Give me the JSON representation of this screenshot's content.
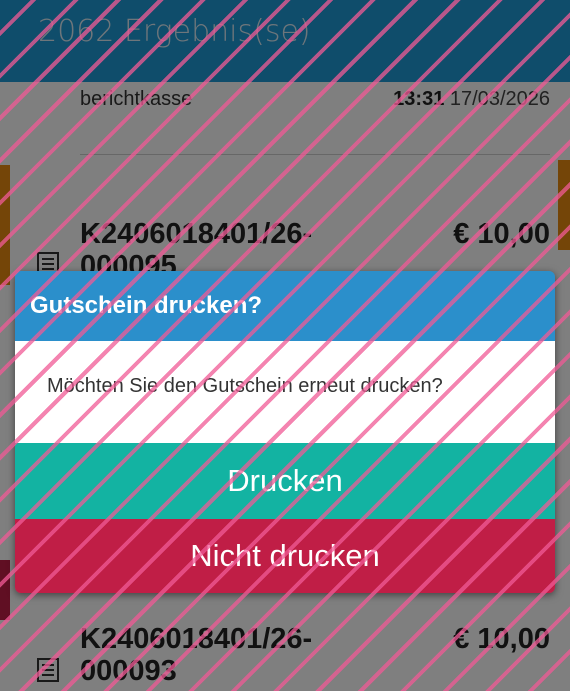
{
  "header": {
    "title": "2062 Ergebnis(se)"
  },
  "list": {
    "top_entry": {
      "user": "berichtkasse",
      "time": "13:31",
      "date": "17/03/2026"
    },
    "items": [
      {
        "number": "K2406018401/26-000095",
        "amount": "€ 10,00",
        "icon": "document-icon"
      },
      {
        "number": "K2406018401/26-000093",
        "amount": "€ 10,00",
        "icon": "document-icon"
      }
    ]
  },
  "dialog": {
    "title": "Gutschein drucken?",
    "message": "Möchten Sie den Gutschein erneut drucken?",
    "print_label": "Drucken",
    "no_print_label": "Nicht drucken"
  },
  "colors": {
    "header": "#1f9ad6",
    "dialog_header": "#2b8fcb",
    "print_button": "#13b3a2",
    "no_print_button": "#c01e46",
    "overlay_stripes": "#f05a96"
  }
}
